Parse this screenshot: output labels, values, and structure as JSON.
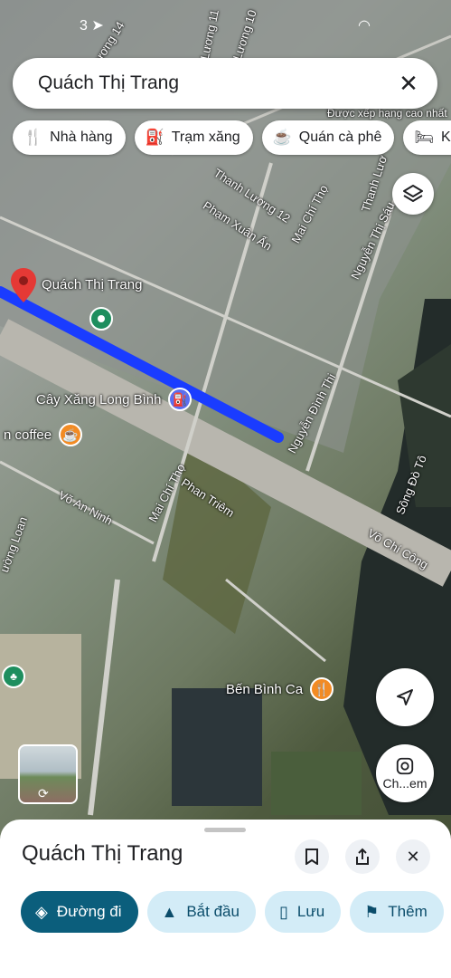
{
  "search": {
    "query": "Quách Thị Trang",
    "clear_icon": "close-icon"
  },
  "chips": [
    {
      "label": "Nhà hàng",
      "icon": "restaurant-icon"
    },
    {
      "label": "Trạm xăng",
      "icon": "gas-station-icon"
    },
    {
      "label": "Quán cà phê",
      "icon": "coffee-icon"
    },
    {
      "label": "Kh",
      "icon": "hotel-icon"
    }
  ],
  "map": {
    "street_labels": [
      "Thanh Lương 12",
      "Mai Chí Thọ",
      "Phạm Xuân Ẩn",
      "Nguyễn Thị Sáu",
      "Nguyễn Đình Thi",
      "Phan Triêm",
      "Võ An Ninh",
      "Võ Chí Công",
      "Mai Chí Thọ",
      "ường Loan",
      "Lương 11",
      "Lương 10",
      "Sông Đò Tô",
      "Thanh Lươ",
      "Lương 14",
      "Được xếp hạng cao nhất"
    ],
    "pin_label": "Quách Thị Trang",
    "pois": [
      {
        "label": "Cây Xăng Long Bình",
        "icon": "gas-station-icon",
        "color": "#5b6ef0"
      },
      {
        "label": "n coffee",
        "icon": "coffee-icon",
        "color": "#f28b24"
      },
      {
        "label": "Bến Bình Ca",
        "icon": "restaurant-icon",
        "color": "#f28b24"
      }
    ],
    "route_color": "#1a3cff"
  },
  "controls": {
    "layers_icon": "layers-icon",
    "location_icon": "navigation-arrow-icon",
    "lens_label": "Ch...em",
    "streetview_icon": "street-view-icon"
  },
  "sheet": {
    "title": "Quách Thị Trang",
    "actions": [
      {
        "label": "Đường đi",
        "icon": "directions-icon"
      },
      {
        "label": "Bắt đầu",
        "icon": "navigation-icon"
      },
      {
        "label": "Lưu",
        "icon": "bookmark-icon"
      },
      {
        "label": "Thêm",
        "icon": "flag-icon"
      }
    ]
  }
}
